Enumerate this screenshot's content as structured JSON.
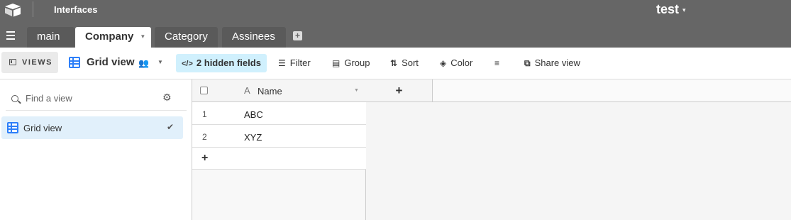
{
  "topbar": {
    "app_title": "Interfaces",
    "base_name": "test",
    "base_caret": "▾"
  },
  "tabs": {
    "menu_icon": "hamburger-icon",
    "items": [
      {
        "label": "main",
        "active": false
      },
      {
        "label": "Company",
        "active": true,
        "caret": "▼"
      },
      {
        "label": "Category",
        "active": false
      },
      {
        "label": "Assinees",
        "active": false
      }
    ],
    "add_label": "+"
  },
  "toolbar": {
    "views_label": "VIEWS",
    "view_name": "Grid view",
    "view_people_icon": "👥",
    "view_caret": "▼",
    "hidden_fields_label": "2 hidden fields",
    "hidden_fields_icon": "</>",
    "filter_label": "Filter",
    "group_label": "Group",
    "sort_label": "Sort",
    "color_label": "Color",
    "share_label": "Share view"
  },
  "sidebar": {
    "search_placeholder": "Find a view",
    "settings_icon": "⚙",
    "views": [
      {
        "label": "Grid view",
        "selected": true,
        "check": "✔"
      }
    ]
  },
  "grid": {
    "columns": [
      {
        "label": "Name",
        "type_icon": "A",
        "caret": "▼"
      }
    ],
    "add_column_label": "+",
    "rows": [
      {
        "num": "1",
        "name": "ABC"
      },
      {
        "num": "2",
        "name": "XYZ"
      }
    ],
    "add_row_label": "+"
  },
  "colors": {
    "topbar_bg": "#666666",
    "accent_blue": "#2d7ff9",
    "hidden_fields_bg": "#d0f0fd",
    "selected_view_bg": "#e1f0fb"
  }
}
